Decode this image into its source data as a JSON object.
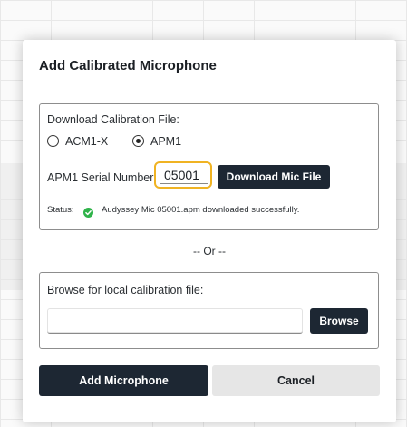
{
  "dialog": {
    "title": "Add Calibrated Microphone",
    "download_section": {
      "heading": "Download Calibration File:",
      "options": [
        {
          "label": "ACM1-X",
          "selected": false
        },
        {
          "label": "APM1",
          "selected": true
        }
      ],
      "serial_label": "APM1 Serial Number:",
      "serial_value": "05001",
      "download_button": "Download Mic File",
      "status_label": "Status:",
      "status_message": "Audyssey Mic  05001.apm downloaded successfully.",
      "status_icon": "check-circle-icon",
      "status_color": "#2fb34a"
    },
    "separator": "-- Or --",
    "browse_section": {
      "heading": "Browse for local calibration file:",
      "file_value": "",
      "browse_button": "Browse"
    },
    "buttons": {
      "add": "Add Microphone",
      "cancel": "Cancel"
    },
    "colors": {
      "primary_button": "#1d2733",
      "focus_border": "#f0b323",
      "secondary_button": "#e6e6e6"
    }
  }
}
